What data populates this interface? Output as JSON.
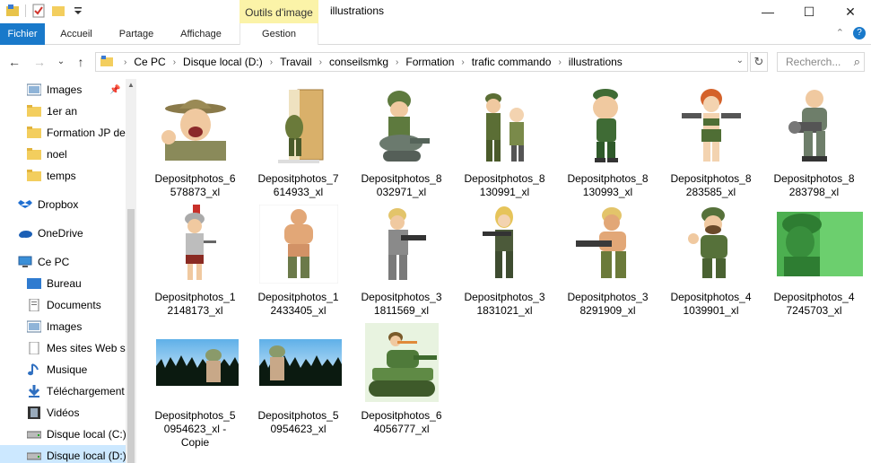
{
  "window": {
    "title": "illustrations",
    "context_tab": "Outils d'image",
    "controls": {
      "minimize": "—",
      "maximize": "☐",
      "close": "✕"
    }
  },
  "ribbon": {
    "tabs": [
      "Fichier",
      "Accueil",
      "Partage",
      "Affichage",
      "Gestion"
    ],
    "collapse": "⌃",
    "help": "?"
  },
  "navigation": {
    "back": "←",
    "forward": "→",
    "recent": "⌄",
    "up": "↑",
    "breadcrumb": [
      "Ce PC",
      "Disque local (D:)",
      "Travail",
      "conseilsmkg",
      "Formation",
      "trafic commando",
      "illustrations"
    ],
    "refresh": "↻",
    "search_placeholder": "Recherch...",
    "search_icon": "⌕"
  },
  "sidebar": {
    "items": [
      {
        "label": "Images",
        "icon": "pictures-icon",
        "pinned": true
      },
      {
        "label": "1er an",
        "icon": "folder-icon"
      },
      {
        "label": "Formation JP de",
        "icon": "folder-icon"
      },
      {
        "label": "noel",
        "icon": "folder-icon"
      },
      {
        "label": "temps",
        "icon": "folder-icon"
      },
      {
        "label": "Dropbox",
        "icon": "dropbox-icon"
      },
      {
        "label": "OneDrive",
        "icon": "onedrive-icon"
      },
      {
        "label": "Ce PC",
        "icon": "computer-icon"
      },
      {
        "label": "Bureau",
        "icon": "desktop-icon"
      },
      {
        "label": "Documents",
        "icon": "documents-icon"
      },
      {
        "label": "Images",
        "icon": "pictures-icon"
      },
      {
        "label": "Mes sites Web su",
        "icon": "web-sites-icon"
      },
      {
        "label": "Musique",
        "icon": "music-icon"
      },
      {
        "label": "Téléchargement",
        "icon": "download-icon"
      },
      {
        "label": "Vidéos",
        "icon": "video-icon"
      },
      {
        "label": "Disque local (C:)",
        "icon": "drive-icon"
      },
      {
        "label": "Disque local (D:)",
        "icon": "drive-icon",
        "selected": true
      }
    ]
  },
  "files": [
    {
      "name": "Depositphotos_6578873_xl",
      "line1": "Depositphotos_6",
      "line2": "578873_xl",
      "art": "drill-sergeant"
    },
    {
      "name": "Depositphotos_7614933_xl",
      "line1": "Depositphotos_7",
      "line2": "614933_xl",
      "art": "soldier-door"
    },
    {
      "name": "Depositphotos_8032971_xl",
      "line1": "Depositphotos_8",
      "line2": "032971_xl",
      "art": "soldier-turret"
    },
    {
      "name": "Depositphotos_8130991_xl",
      "line1": "Depositphotos_8",
      "line2": "130991_xl",
      "art": "two-soldiers"
    },
    {
      "name": "Depositphotos_8130993_xl",
      "line1": "Depositphotos_8",
      "line2": "130993_xl",
      "art": "soldier-cap"
    },
    {
      "name": "Depositphotos_8283585_xl",
      "line1": "Depositphotos_8",
      "line2": "283585_xl",
      "art": "woman-guns"
    },
    {
      "name": "Depositphotos_8283798_xl",
      "line1": "Depositphotos_8",
      "line2": "283798_xl",
      "art": "minigun-soldier"
    },
    {
      "name": "Depositphotos_12148173_xl",
      "line1": "Depositphotos_1",
      "line2": "2148173_xl",
      "art": "roman-soldier"
    },
    {
      "name": "Depositphotos_12433405_xl",
      "line1": "Depositphotos_1",
      "line2": "2433405_xl",
      "art": "muscle-soldier"
    },
    {
      "name": "Depositphotos_31811569_xl",
      "line1": "Depositphotos_3",
      "line2": "1811569_xl",
      "art": "camo-rifle-man"
    },
    {
      "name": "Depositphotos_31831021_xl",
      "line1": "Depositphotos_3",
      "line2": "1831021_xl",
      "art": "camo-rifle-woman"
    },
    {
      "name": "Depositphotos_38291909_xl",
      "line1": "Depositphotos_3",
      "line2": "8291909_xl",
      "art": "commando-gun"
    },
    {
      "name": "Depositphotos_41039901_xl",
      "line1": "Depositphotos_4",
      "line2": "1039901_xl",
      "art": "thumbs-up-soldier"
    },
    {
      "name": "Depositphotos_47245703_xl",
      "line1": "Depositphotos_4",
      "line2": "7245703_xl",
      "art": "green-toy-soldier"
    },
    {
      "name": "Depositphotos_50954623_xl - Copie",
      "line1": "Depositphotos_5",
      "line2": "0954623_xl -",
      "line3": "Copie",
      "art": "grass-soldier"
    },
    {
      "name": "Depositphotos_50954623_xl",
      "line1": "Depositphotos_5",
      "line2": "0954623_xl",
      "art": "grass-soldier"
    },
    {
      "name": "Depositphotos_64056777_xl",
      "line1": "Depositphotos_6",
      "line2": "4056777_xl",
      "art": "cartoon-tank"
    }
  ],
  "colors": {
    "accent": "#1979ca",
    "selection": "#cce8ff",
    "context_tab": "#fbf3a8",
    "army_green": "#4f7a3a"
  }
}
